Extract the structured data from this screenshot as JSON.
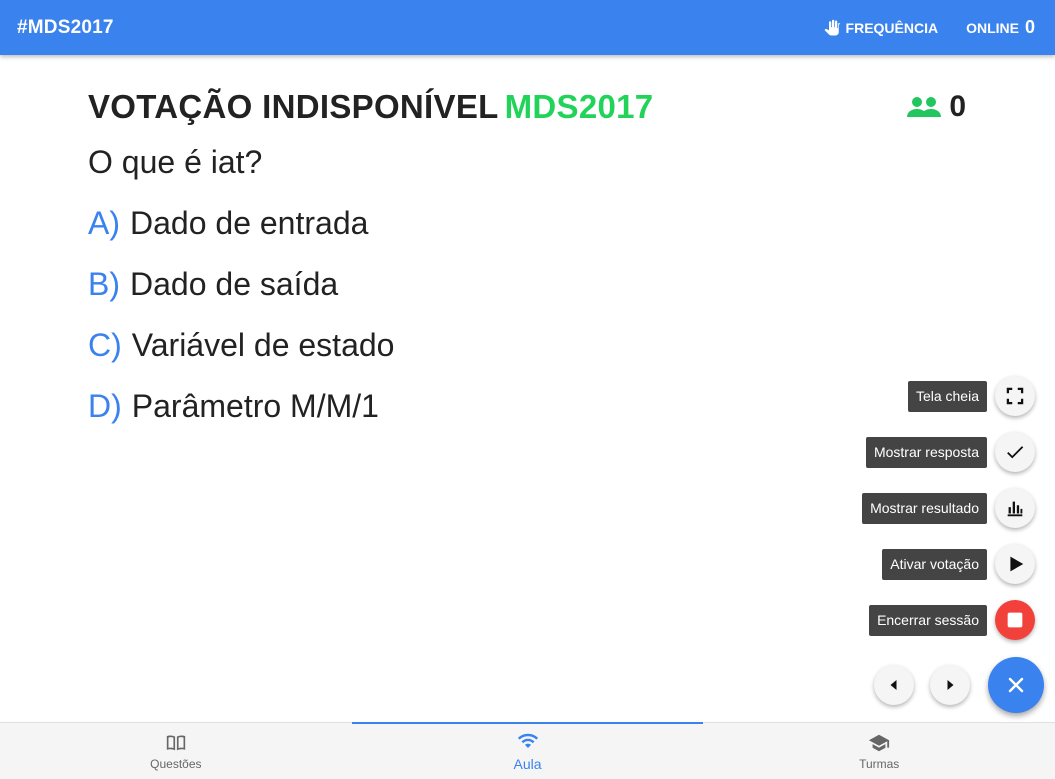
{
  "appbar": {
    "title": "#MDS2017",
    "frequency_label": "FREQUÊNCIA",
    "online_label": "ONLINE",
    "online_count": "0"
  },
  "poll": {
    "status": "VOTAÇÃO INDISPONÍVEL",
    "code": "MDS2017",
    "voters_count": "0",
    "question": "O que é iat?",
    "options": [
      {
        "letter": "A)",
        "text": "Dado de entrada"
      },
      {
        "letter": "B)",
        "text": "Dado de saída"
      },
      {
        "letter": "C)",
        "text": "Variável de estado"
      },
      {
        "letter": "D)",
        "text": "Parâmetro M/M/1"
      }
    ]
  },
  "actions": {
    "fullscreen": "Tela cheia",
    "show_answer": "Mostrar resposta",
    "show_result": "Mostrar resultado",
    "activate_vote": "Ativar votação",
    "end_session": "Encerrar sessão"
  },
  "bottom_nav": {
    "questions": "Questões",
    "class": "Aula",
    "classes": "Turmas"
  },
  "colors": {
    "primary": "#3a82ee",
    "accent_green": "#22d35a",
    "danger": "#f2413b"
  }
}
